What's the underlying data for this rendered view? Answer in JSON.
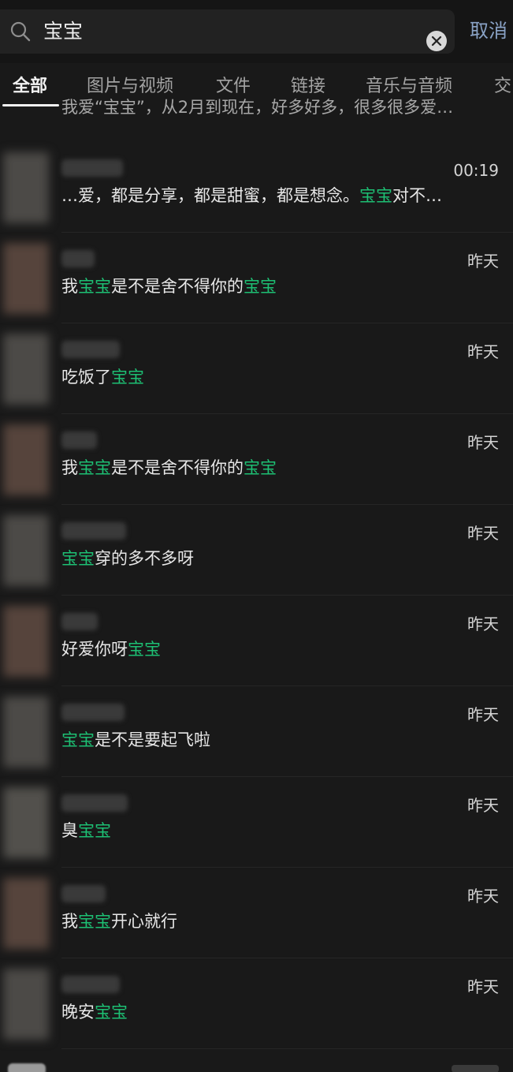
{
  "search": {
    "query": "宝宝",
    "cancel_label": "取消",
    "icons": {
      "search": "search-icon",
      "clear": "clear-icon"
    }
  },
  "tabs": [
    {
      "label": "全部"
    },
    {
      "label": "图片与视频"
    },
    {
      "label": "文件"
    },
    {
      "label": "链接"
    },
    {
      "label": "音乐与音频"
    },
    {
      "label": "交"
    }
  ],
  "clipped_snippet": "我爱“宝宝”，从2月到现在，好多好多，很多很多爱…",
  "results": [
    {
      "time": "00:19",
      "message": {
        "before": "…爱，都是分享，都是甜蜜，都是想念。",
        "highlight": "宝宝",
        "after": "对不…"
      }
    },
    {
      "time": "昨天",
      "message": {
        "before": "我",
        "highlight": "宝宝",
        "after": "是不是舍不得你的",
        "highlight2": "宝宝"
      }
    },
    {
      "time": "昨天",
      "message": {
        "before": "吃饭了",
        "highlight": "宝宝",
        "after": ""
      }
    },
    {
      "time": "昨天",
      "message": {
        "before": "我",
        "highlight": "宝宝",
        "after": "是不是舍不得你的",
        "highlight2": "宝宝"
      }
    },
    {
      "time": "昨天",
      "message": {
        "before": "",
        "highlight": "宝宝",
        "after": "穿的多不多呀"
      }
    },
    {
      "time": "昨天",
      "message": {
        "before": "好爱你呀",
        "highlight": "宝宝",
        "after": ""
      }
    },
    {
      "time": "昨天",
      "message": {
        "before": "",
        "highlight": "宝宝",
        "after": "是不是要起飞啦"
      }
    },
    {
      "time": "昨天",
      "message": {
        "before": "臭",
        "highlight": "宝宝",
        "after": ""
      }
    },
    {
      "time": "昨天",
      "message": {
        "before": "我",
        "highlight": "宝宝",
        "after": "开心就行"
      }
    },
    {
      "time": "昨天",
      "message": {
        "before": "晚安",
        "highlight": "宝宝",
        "after": ""
      }
    }
  ],
  "colors": {
    "background": "#191919",
    "highlight": "#1dbf73",
    "cancel": "#8aa3c6",
    "text": "#e7e7e7"
  }
}
